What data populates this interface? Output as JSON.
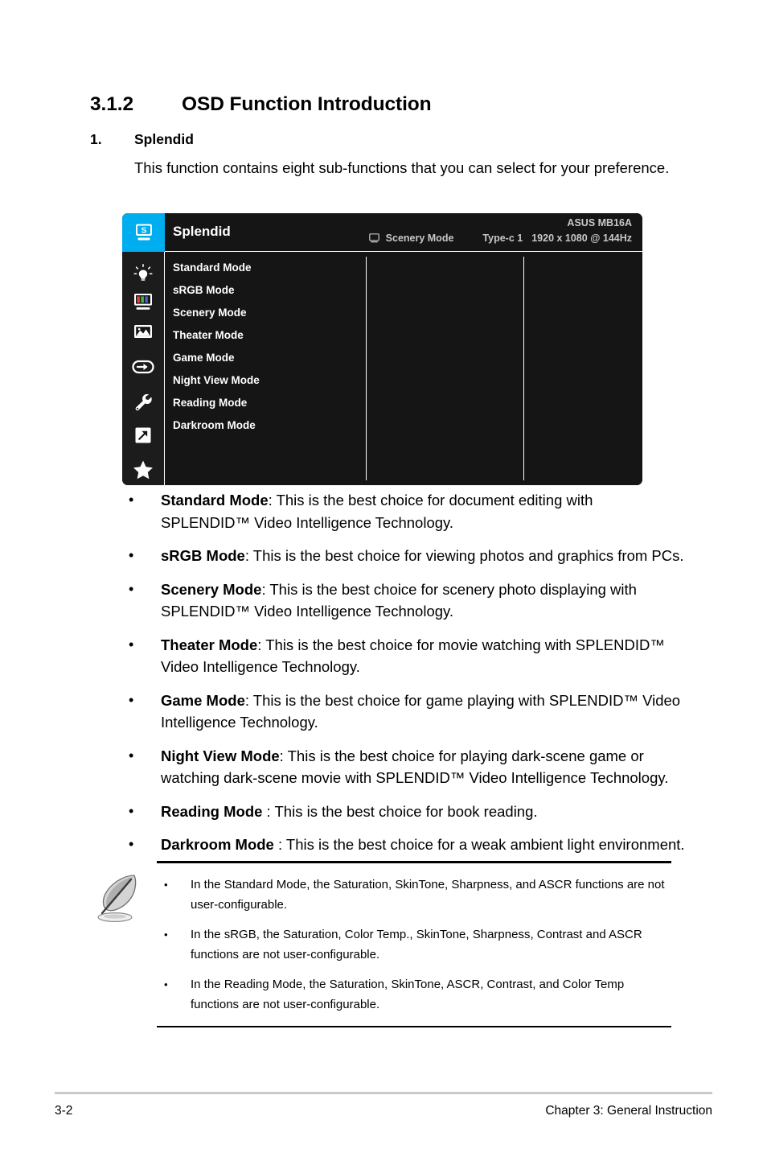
{
  "heading": {
    "number": "3.1.2",
    "title": "OSD Function Introduction"
  },
  "item": {
    "index": "1.",
    "label": "Splendid",
    "description": "This function contains eight sub-functions that you can select for your preference."
  },
  "osd": {
    "logo_letter": "S",
    "title": "Splendid",
    "model": "ASUS MB16A",
    "current_mode": "Scenery Mode",
    "source": "Type-c 1",
    "resolution": "1920 x 1080 @ 144Hz",
    "accent_color": "#00aeef",
    "background_color": "#151515",
    "sidebar_icons": [
      "splendid-monitor-icon",
      "bluelight-bulb-icon",
      "color-bars-icon",
      "image-picture-icon",
      "input-select-icon",
      "system-wrench-icon",
      "shortcut-arrow-icon",
      "myfavorite-star-icon"
    ],
    "menu_items": [
      "Standard Mode",
      "sRGB Mode",
      "Scenery Mode",
      "Theater Mode",
      "Game Mode",
      "Night View Mode",
      "Reading Mode",
      "Darkroom Mode"
    ]
  },
  "bullets": [
    {
      "marker": "•",
      "term": "Standard Mode",
      "rest": ": This is the best choice for document editing with SPLENDID™ Video Intelligence Technology."
    },
    {
      "marker": "•",
      "term": "sRGB Mode",
      "rest": ": This is the best choice for viewing photos and graphics from PCs."
    },
    {
      "marker": "•",
      "term": "Scenery Mode",
      "rest": ": This is the best choice for scenery photo displaying with SPLENDID™ Video Intelligence Technology."
    },
    {
      "marker": "•",
      "term": "Theater Mode",
      "rest": ": This is the best choice for movie watching with SPLENDID™ Video Intelligence Technology."
    },
    {
      "marker": "•",
      "term": "Game Mode",
      "rest": ": This is the best choice for game playing with SPLENDID™ Video Intelligence Technology."
    },
    {
      "marker": "•",
      "term": "Night View Mode",
      "rest": ": This is the best choice for playing dark-scene game or watching dark-scene movie with SPLENDID™ Video Intelligence Technology."
    },
    {
      "marker": "•",
      "term": "Reading Mode",
      "rest": " : This is the best choice for book reading."
    },
    {
      "marker": "•",
      "term": "Darkroom Mode",
      "rest": " : This is the best choice for a weak ambient light environment."
    }
  ],
  "note": {
    "icon": "quill-pen-icon",
    "marker": "•",
    "lines": [
      "In the Standard Mode, the Saturation, SkinTone, Sharpness, and ASCR functions are not user-configurable.",
      "In the sRGB, the Saturation, Color Temp., SkinTone, Sharpness, Contrast and ASCR functions are not user-configurable.",
      "In the Reading Mode, the Saturation, SkinTone, ASCR, Contrast, and Color Temp functions are not user-configurable."
    ]
  },
  "footer": {
    "page_number": "3-2",
    "chapter": "Chapter 3: General Instruction"
  }
}
